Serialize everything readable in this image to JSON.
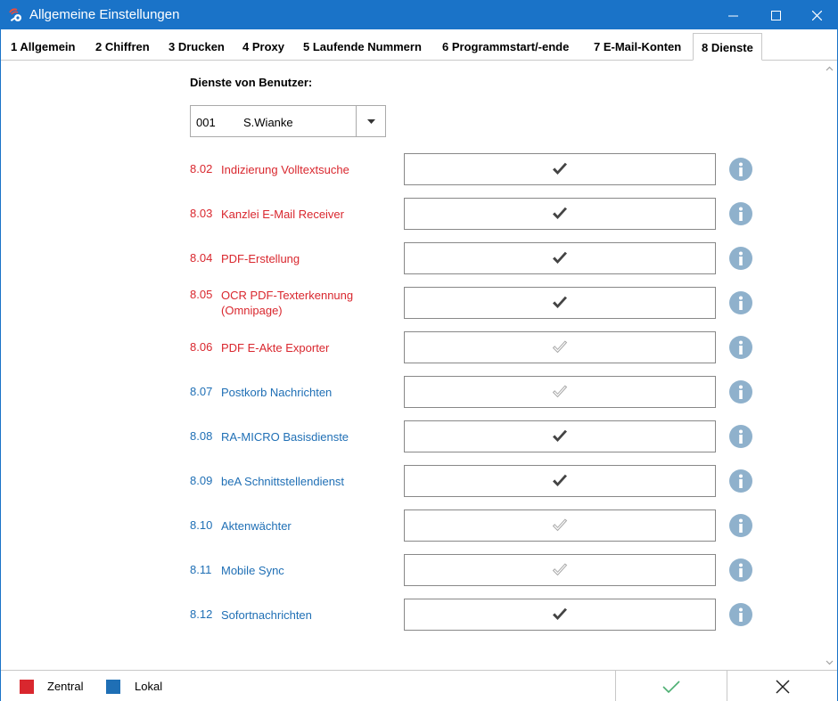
{
  "window": {
    "title": "Allgemeine Einstellungen",
    "accent_color": "#1a73c8",
    "icons": {
      "app": "settings-wrench-icon",
      "minimize": "minimize-icon",
      "maximize": "maximize-icon",
      "close": "close-icon"
    }
  },
  "tabs": [
    {
      "label": "1 Allgemein",
      "active": false
    },
    {
      "label": "2 Chiffren",
      "active": false
    },
    {
      "label": "3 Drucken",
      "active": false
    },
    {
      "label": "4 Proxy",
      "active": false
    },
    {
      "label": "5 Laufende Nummern",
      "active": false
    },
    {
      "label": "6 Programmstart/-ende",
      "active": false
    },
    {
      "label": "7 E-Mail-Konten",
      "active": false
    },
    {
      "label": "8 Dienste",
      "active": true
    }
  ],
  "main": {
    "section_label": "Dienste von Benutzer:",
    "user_select": {
      "number": "001",
      "name": "S.Wianke",
      "icon": "chevron-down-icon"
    },
    "colors": {
      "zentral": "#d9272e",
      "lokal": "#1f6fb5",
      "check_dark": "#444444",
      "check_light": "#a8a8a8",
      "info": "#8fb1cc"
    },
    "services": [
      {
        "code": "8.02",
        "label": "Indizierung Volltextsuche",
        "scope": "zentral",
        "checked": true
      },
      {
        "code": "8.03",
        "label": "Kanzlei E-Mail Receiver",
        "scope": "zentral",
        "checked": true
      },
      {
        "code": "8.04",
        "label": "PDF-Erstellung",
        "scope": "zentral",
        "checked": true
      },
      {
        "code": "8.05",
        "label": "OCR PDF-Texterkennung (Omnipage)",
        "scope": "zentral",
        "checked": true
      },
      {
        "code": "8.06",
        "label": "PDF E-Akte Exporter",
        "scope": "zentral",
        "checked": false
      },
      {
        "code": "8.07",
        "label": "Postkorb Nachrichten",
        "scope": "lokal",
        "checked": false
      },
      {
        "code": "8.08",
        "label": "RA-MICRO Basisdienste",
        "scope": "lokal",
        "checked": true
      },
      {
        "code": "8.09",
        "label": "beA Schnittstellendienst",
        "scope": "lokal",
        "checked": true
      },
      {
        "code": "8.10",
        "label": "Aktenwächter",
        "scope": "lokal",
        "checked": false
      },
      {
        "code": "8.11",
        "label": "Mobile Sync",
        "scope": "lokal",
        "checked": false
      },
      {
        "code": "8.12",
        "label": "Sofortnachrichten",
        "scope": "lokal",
        "checked": true
      }
    ]
  },
  "footer": {
    "legend": [
      {
        "label": "Zentral",
        "color": "#d9272e"
      },
      {
        "label": "Lokal",
        "color": "#1f6fb5"
      }
    ],
    "ok_icon": "checkmark-icon",
    "cancel_icon": "close-icon"
  }
}
